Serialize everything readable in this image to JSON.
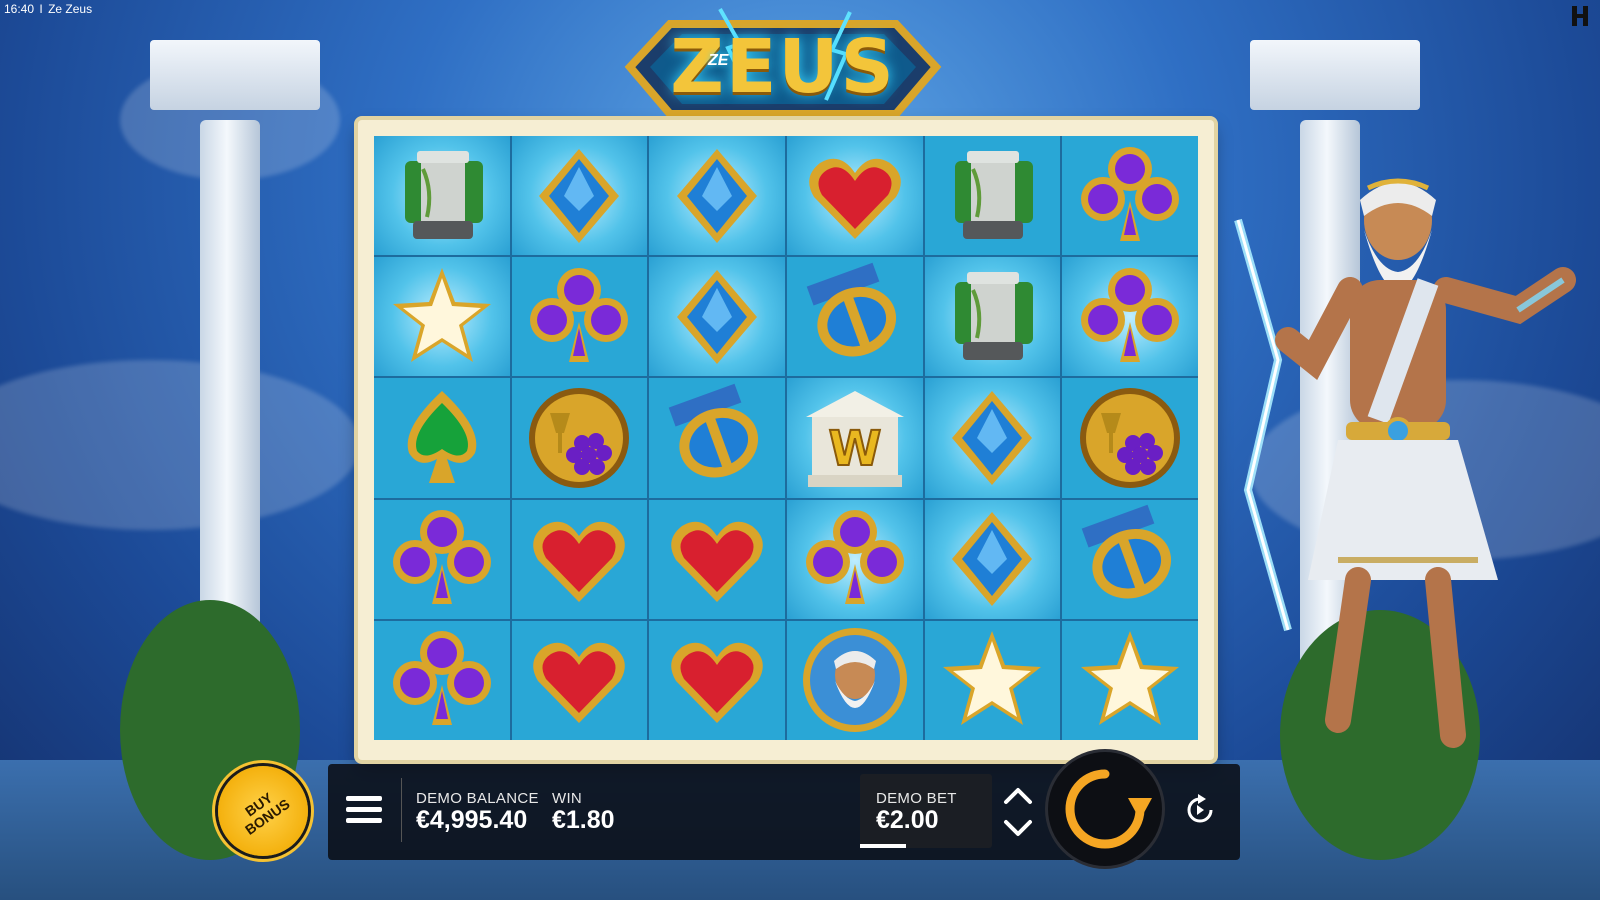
{
  "status_bar": {
    "time": "16:40",
    "title": "Ze Zeus",
    "separator": "I"
  },
  "logo": {
    "main": "ZEUS",
    "sub": "ZE"
  },
  "reels": [
    [
      "column",
      "diamond",
      "diamond",
      "heart",
      "column",
      "club"
    ],
    [
      "star",
      "club",
      "diamond",
      "shield",
      "column",
      "club"
    ],
    [
      "spade",
      "grapes",
      "shield",
      "wild",
      "diamond",
      "grapes"
    ],
    [
      "club",
      "heart",
      "heart",
      "club",
      "diamond",
      "shield"
    ],
    [
      "club",
      "heart",
      "heart",
      "zeus",
      "star",
      "star"
    ]
  ],
  "wild_letter": "W",
  "controls": {
    "buy_bonus_line1": "BUY",
    "buy_bonus_line2": "BONUS",
    "balance_label": "DEMO BALANCE",
    "balance_value": "€4,995.40",
    "win_label": "WIN",
    "win_value": "€1.80",
    "bet_label": "DEMO BET",
    "bet_value": "€2.00"
  },
  "icons": {
    "menu": "hamburger-menu-icon",
    "bet_up": "chevron-up-icon",
    "bet_down": "chevron-down-icon",
    "spin": "spin-arrow-icon",
    "autoplay": "autoplay-icon"
  },
  "colors": {
    "gold": "#f3c53a",
    "board_frame": "#f6eed3",
    "tile_blue": "#29a7d6",
    "bar_bg": "#0a0e16"
  }
}
